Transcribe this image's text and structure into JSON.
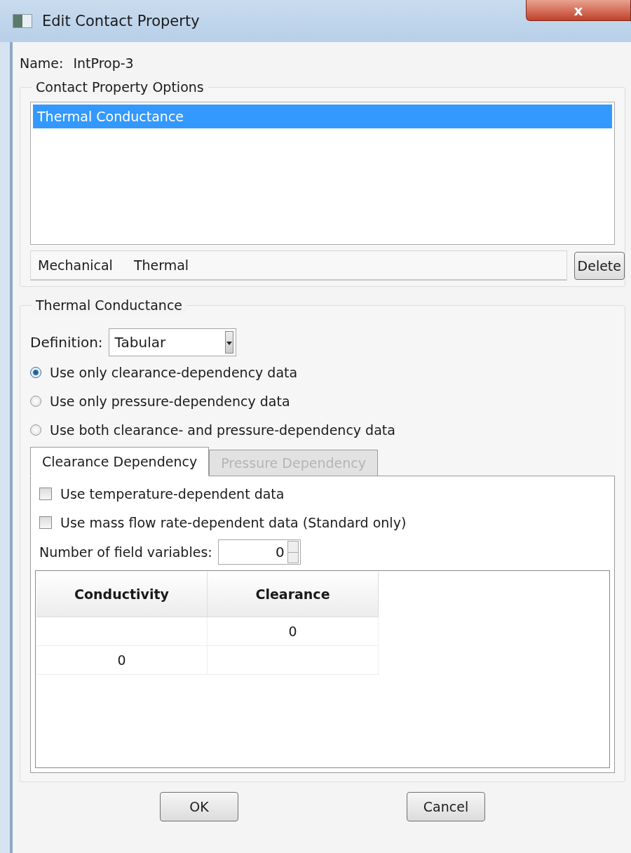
{
  "window": {
    "title": "Edit Contact Property",
    "close": "x"
  },
  "name": {
    "label": "Name:",
    "value": "IntProp-3"
  },
  "options": {
    "title": "Contact Property Options",
    "items": [
      {
        "label": "Thermal Conductance",
        "selected": true
      }
    ],
    "menus": [
      "Mechanical",
      "Thermal"
    ],
    "delete": "Delete"
  },
  "conductance": {
    "title": "Thermal Conductance",
    "definition": {
      "label": "Definition:",
      "value": "Tabular"
    },
    "radios": [
      {
        "label": "Use only clearance-dependency data",
        "selected": true
      },
      {
        "label": "Use only pressure-dependency data",
        "selected": false
      },
      {
        "label": "Use both clearance- and pressure-dependency data",
        "selected": false
      }
    ],
    "tabs": [
      {
        "label": "Clearance Dependency",
        "selected": true,
        "disabled": false
      },
      {
        "label": "Pressure Dependency",
        "selected": false,
        "disabled": true
      }
    ],
    "checkboxes": [
      {
        "label": "Use temperature-dependent data",
        "checked": false
      },
      {
        "label": "Use mass flow rate-dependent data (Standard only)",
        "checked": false
      }
    ],
    "field_variables": {
      "label": "Number of field variables:",
      "value": "0"
    },
    "table": {
      "columns": [
        "Conductivity",
        "Clearance"
      ],
      "rows": [
        [
          "",
          "0"
        ],
        [
          "0",
          ""
        ]
      ]
    }
  },
  "buttons": [
    "OK",
    "Cancel"
  ]
}
